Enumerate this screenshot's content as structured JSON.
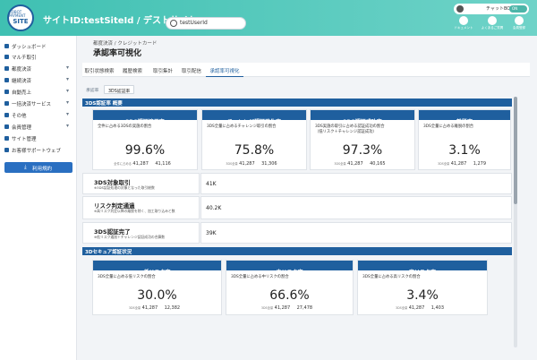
{
  "header": {
    "logo_top": "ROBOT PAYMENT",
    "logo_main": "SITE",
    "title": "サイトID:testSiteId / デストサイト",
    "search_value": "testUserId",
    "chatbot_label": "チャットBOT",
    "chatbot_toggle": "ON",
    "icons": [
      {
        "name": "document-icon",
        "label": "ドキュメント"
      },
      {
        "name": "faq-icon",
        "label": "よくあるご質問"
      },
      {
        "name": "user-icon",
        "label": "会員登録"
      }
    ]
  },
  "sidebar": {
    "items": [
      {
        "label": "ダッシュボード",
        "chevron": false
      },
      {
        "label": "マルチ取引",
        "chevron": false
      },
      {
        "label": "都度決済",
        "chevron": true
      },
      {
        "label": "継続決済",
        "chevron": true
      },
      {
        "label": "自動売上",
        "chevron": true
      },
      {
        "label": "一括決済サービス",
        "chevron": true
      },
      {
        "label": "その他",
        "chevron": true
      },
      {
        "label": "会員管理",
        "chevron": true
      },
      {
        "label": "サイト管理",
        "chevron": false
      },
      {
        "label": "お客様サポートウェブ",
        "chevron": false
      }
    ],
    "contract_button": "利用規約"
  },
  "main": {
    "breadcrumb": "都度決済 / クレジットカード",
    "title": "承認率可視化",
    "tabs": [
      "取引状態検索",
      "履歴検索",
      "取引集計",
      "取引配信",
      "承認率可視化"
    ],
    "active_tab": 4,
    "subtabs": [
      "承認率",
      "3DS認証率"
    ],
    "section1_title": "3DS認証率 概要",
    "section2_title": "3Dセキュア認証状況",
    "cards1": [
      {
        "title": "3DS認証適用率",
        "desc1": "全件に占める3DSの実施の割合",
        "desc2": "",
        "value": "99.6%",
        "sub_label": "全件に占める",
        "n1": "41,287",
        "n2": "41,116"
      },
      {
        "title": "チャレンジ認証発生率",
        "desc1": "3DS全量に占めるチャレンジ取引の割合",
        "desc2": "",
        "value": "75.8%",
        "sub_label": "3DS全量",
        "n1": "41,287",
        "n2": "31,306"
      },
      {
        "title": "3DS認証成功率",
        "desc1": "3DS実施の取引に占める認証成功の割合",
        "desc2": "（低リスク＋チャレンジ認証成功）",
        "value": "97.3%",
        "sub_label": "3DS全量",
        "n1": "41,287",
        "n2": "40,165"
      },
      {
        "title": "離脱率",
        "desc1": "3DS全量に占める離脱の割合",
        "desc2": "",
        "value": "3.1%",
        "sub_label": "3DS全量",
        "n1": "41,287",
        "n2": "1,279"
      }
    ],
    "rows": [
      {
        "title": "3DS対象取引",
        "note": "※3DS認証処理の対象となった取引総数",
        "value": "41K"
      },
      {
        "title": "リスク判定通過",
        "note": "※高リスク判定以降の離脱を除く、加工取り込みと数",
        "value": "40.2K"
      },
      {
        "title": "3DS認証完了",
        "note": "※低リスク通過＋チャレンジ認証成功の合算数",
        "value": "39K"
      }
    ],
    "cards2": [
      {
        "title": "低リスク率",
        "desc1": "3DS全量に占める低リスクの割合",
        "value": "30.0%",
        "sub_label": "3DS全量",
        "n1": "41,287",
        "n2": "12,382"
      },
      {
        "title": "中リスク率",
        "desc1": "3DS全量に占める中リスクの割合",
        "value": "66.6%",
        "sub_label": "3DS全量",
        "n1": "41,287",
        "n2": "27,478"
      },
      {
        "title": "高リスク率",
        "desc1": "3DS全量に占める高リスクの割合",
        "value": "3.4%",
        "sub_label": "3DS全量",
        "n1": "41,287",
        "n2": "1,403"
      }
    ]
  }
}
